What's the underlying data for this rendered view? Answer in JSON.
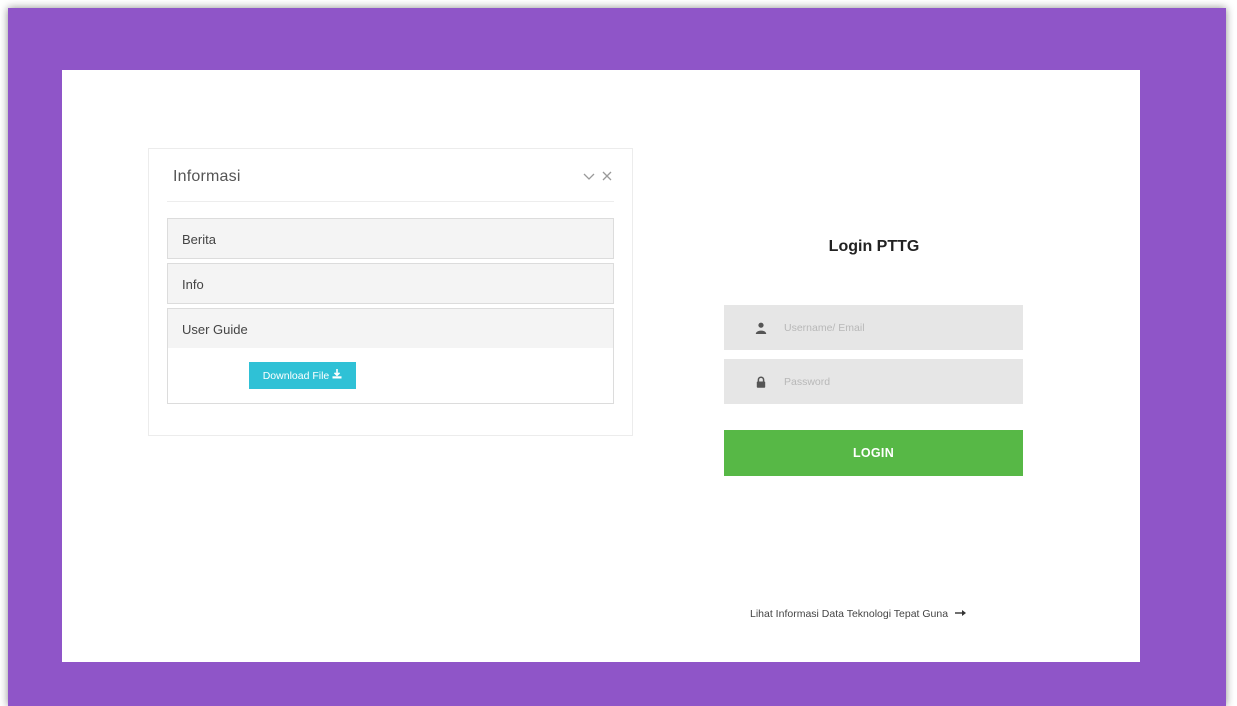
{
  "info_panel": {
    "title": "Informasi",
    "collapse_icon": "chevron-down-icon",
    "close_icon": "close-icon",
    "items": [
      {
        "label": "Berita"
      },
      {
        "label": "Info"
      },
      {
        "label": "User Guide"
      }
    ],
    "download_label": "Download File",
    "download_icon": "download-icon"
  },
  "login": {
    "title": "Login PTTG",
    "username_placeholder": "Username/ Email",
    "password_placeholder": "Password",
    "username_icon": "user-icon",
    "password_icon": "lock-icon",
    "button_label": "LOGIN",
    "link_label": "Lihat Informasi Data Teknologi Tepat Guna",
    "link_icon": "arrow-right-icon"
  },
  "colors": {
    "frame_background": "#8f55c8",
    "login_button": "#57b846",
    "download_button": "#2fc1d6"
  }
}
